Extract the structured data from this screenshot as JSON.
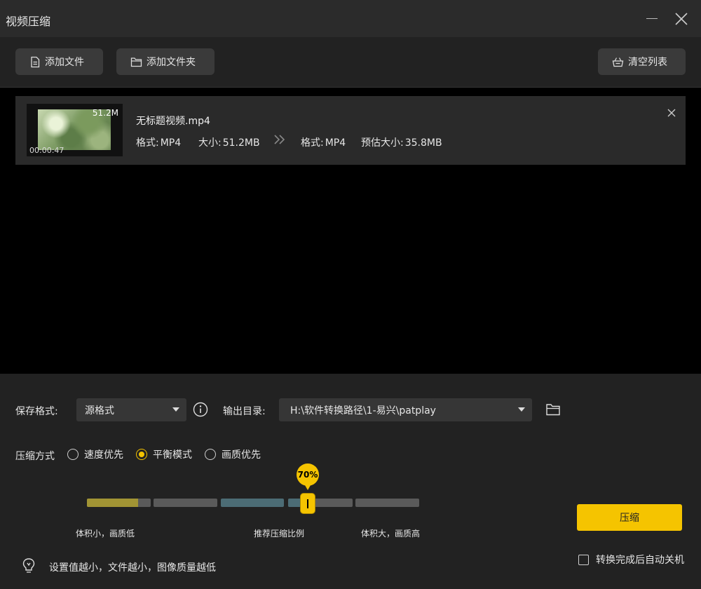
{
  "window": {
    "title": "视频压缩"
  },
  "toolbar": {
    "add_file": "添加文件",
    "add_folder": "添加文件夹",
    "clear_list": "清空列表"
  },
  "file": {
    "name": "无标题视频.mp4",
    "thumb_size": "51.2M",
    "duration": "00:00:47",
    "format_label": "格式:",
    "format": "MP4",
    "size_label": "大小:",
    "size": "51.2MB",
    "out_format_label": "格式:",
    "out_format": "MP4",
    "est_size_label": "预估大小:",
    "est_size": "35.8MB"
  },
  "settings": {
    "save_format_label": "保存格式:",
    "save_format_value": "源格式",
    "output_dir_label": "输出目录:",
    "output_dir_value": "H:\\软件转换路径\\1-易兴\\patplay",
    "mode_label": "压缩方式",
    "modes": [
      "速度优先",
      "平衡模式",
      "画质优先"
    ],
    "selected_mode": "平衡模式",
    "ratio_percent": 70,
    "ratio_label": "70%",
    "label_small": "体积小，画质低",
    "label_recommended": "推荐压缩比例",
    "label_large": "体积大，画质高",
    "tip": "设置值越小，文件越小，图像质量越低",
    "compress_button": "压缩",
    "auto_shutdown": "转换完成后自动关机",
    "auto_shutdown_checked": false
  },
  "colors": {
    "accent": "#f5c400",
    "segment_yellow": "#a19434",
    "segment_gray": "#5a5a5a",
    "segment_teal": "#4c6c75"
  }
}
